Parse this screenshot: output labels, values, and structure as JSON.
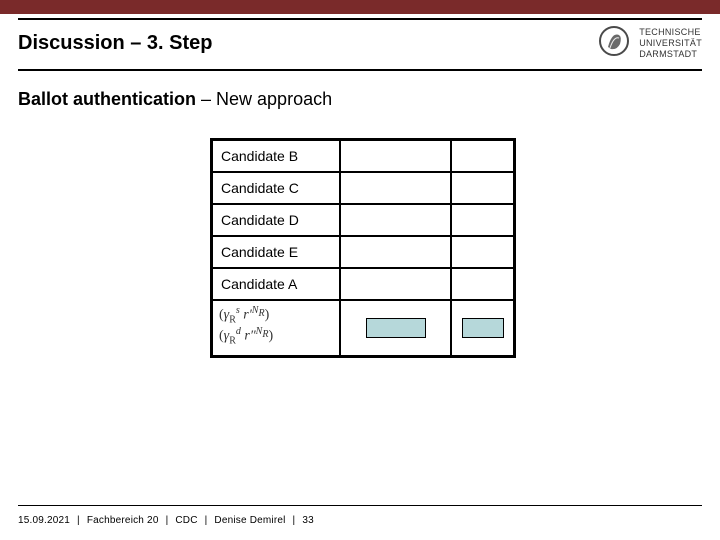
{
  "header": {
    "title": "Discussion – 3. Step"
  },
  "logo": {
    "line1": "TECHNISCHE",
    "line2": "UNIVERSITÄT",
    "line3": "DARMSTADT"
  },
  "section": {
    "bold": "Ballot authentication",
    "rest": " – New approach"
  },
  "table": {
    "rows": [
      {
        "name": "Candidate B"
      },
      {
        "name": "Candidate C"
      },
      {
        "name": "Candidate D"
      },
      {
        "name": "Candidate E"
      },
      {
        "name": "Candidate A"
      }
    ],
    "formula_line1": "(γ_R^s  r'^{N_R})",
    "formula_line2": "(γ_R^d  r''^{N_R})"
  },
  "footer": {
    "date": "15.09.2021",
    "dept": "Fachbereich 20",
    "unit": "CDC",
    "author": "Denise Demirel",
    "page": "33",
    "sep": "|"
  }
}
